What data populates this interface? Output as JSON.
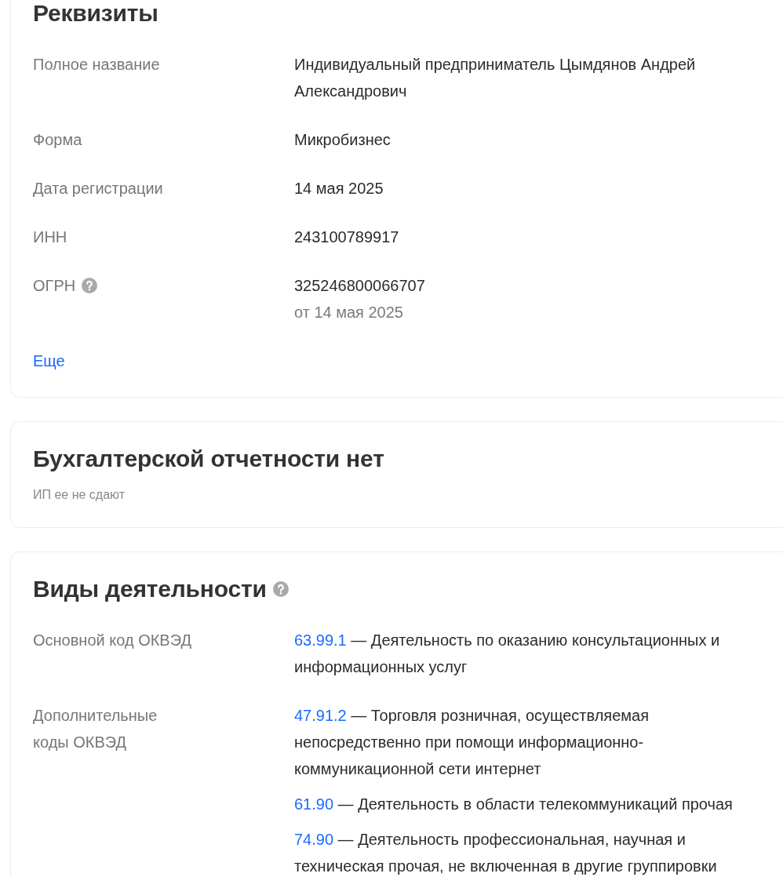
{
  "sections": [
    {
      "kind": "details",
      "title": "Реквизиты",
      "title_info_icon": false,
      "rows": [
        {
          "label": "Полное название",
          "info_icon": false,
          "value": "Индивидуальный предприниматель Цымдянов Андрей Александрович"
        },
        {
          "label": "Форма",
          "info_icon": false,
          "value": "Микробизнес"
        },
        {
          "label": "Дата регистрации",
          "info_icon": false,
          "value": "14 мая 2025"
        },
        {
          "label": "ИНН",
          "info_icon": false,
          "value": "243100789917"
        },
        {
          "label": "ОГРН",
          "info_icon": true,
          "value": "325246800066707",
          "note": "от 14 мая 2025"
        }
      ],
      "more_link": "Еще"
    },
    {
      "kind": "notice",
      "title": "Бухгалтерской отчетности нет",
      "title_info_icon": false,
      "subtitle": "ИП ее не сдают"
    },
    {
      "kind": "activities",
      "title": "Виды деятельности",
      "title_info_icon": true,
      "rows": [
        {
          "label": "Основной код ОКВЭД",
          "info_icon": false,
          "items": [
            {
              "code": "63.99.1",
              "description": "— Деятельность по оказанию консультационных и информационных услуг"
            }
          ]
        },
        {
          "label": "Дополнительные коды ОКВЭД",
          "info_icon": false,
          "items": [
            {
              "code": "47.91.2",
              "description": "— Торговля розничная, осуществляемая непосредственно при помощи информационно-коммуникационной сети интернет"
            },
            {
              "code": "61.90",
              "description": "— Деятельность в области телекоммуникаций прочая"
            },
            {
              "code": "74.90",
              "description": "— Деятельность профессиональная, научная и техническая прочая, не включенная в другие группировки"
            }
          ]
        }
      ]
    }
  ]
}
